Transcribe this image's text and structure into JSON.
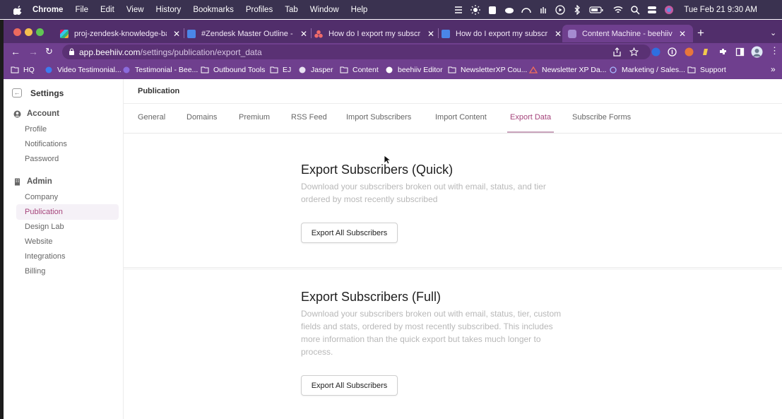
{
  "menubar": {
    "app": "Chrome",
    "items": [
      "File",
      "Edit",
      "View",
      "History",
      "Bookmarks",
      "Profiles",
      "Tab",
      "Window",
      "Help"
    ],
    "clock": "Tue Feb 21  9:30 AM"
  },
  "tabs": [
    {
      "title": "proj-zendesk-knowledge-base",
      "icon": "slack-icon"
    },
    {
      "title": "#Zendesk Master Outline - Goo",
      "icon": "docs-icon"
    },
    {
      "title": "How do I export my subscriber",
      "icon": "asana-icon"
    },
    {
      "title": "How do I export my subscriber",
      "icon": "docs-icon"
    },
    {
      "title": "Content Machine - beehiiv",
      "icon": "beehiiv-icon",
      "active": true
    }
  ],
  "address_bar": {
    "host": "app.beehiiv.com",
    "path": "/settings/publication/export_data"
  },
  "bookmarks": [
    "HQ",
    "Video Testimonial...",
    "Testimonial - Bee...",
    "Outbound Tools",
    "EJ",
    "Jasper",
    "Content",
    "beehiiv Editor",
    "NewsletterXP Cou...",
    "Newsletter XP Da...",
    "Marketing / Sales...",
    "Support"
  ],
  "sidebar": {
    "title": "Settings",
    "account": {
      "label": "Account",
      "items": [
        "Profile",
        "Notifications",
        "Password"
      ]
    },
    "admin": {
      "label": "Admin",
      "items": [
        "Company",
        "Publication",
        "Design Lab",
        "Website",
        "Integrations",
        "Billing"
      ],
      "active": "Publication"
    }
  },
  "main": {
    "title": "Publication",
    "tabs": [
      "General",
      "Domains",
      "Premium",
      "RSS Feed",
      "Import Subscribers",
      "Import Content",
      "Export Data",
      "Subscribe Forms"
    ],
    "active_tab": "Export Data",
    "sections": [
      {
        "heading": "Export Subscribers (Quick)",
        "description": "Download your subscribers broken out with email, status, and tier ordered by most recently subscribed",
        "button": "Export All Subscribers"
      },
      {
        "heading": "Export Subscribers (Full)",
        "description": "Download your subscribers broken out with email, status, tier, custom fields and stats, ordered by most recently subscribed. This includes more information than the quick export but takes much longer to process.",
        "button": "Export All Subscribers"
      }
    ]
  },
  "colors": {
    "accent": "#a6457c",
    "chrome_frame": "#512e6b",
    "chrome_toolbar": "#6f3f8e",
    "menubar": "#3a3250"
  }
}
